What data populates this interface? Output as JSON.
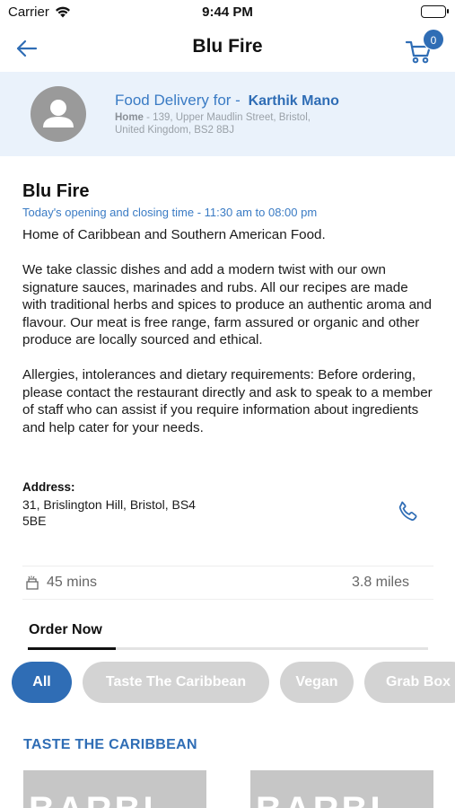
{
  "status_bar": {
    "carrier": "Carrier",
    "time": "9:44 PM"
  },
  "nav": {
    "title": "Blu Fire",
    "cart_count": "0"
  },
  "delivery": {
    "prefix": "Food Delivery for -",
    "customer_name": "Karthik Mano",
    "address_label": "Home",
    "address_text": " - 139, Upper Maudlin Street, Bristol, United Kingdom, BS2 8BJ"
  },
  "restaurant": {
    "name": "Blu Fire",
    "hours": "Today's opening and closing time - 11:30 am to 08:00 pm",
    "tagline": "Home of Caribbean and Southern American Food.",
    "description": "We take classic dishes and add a modern twist with our own signature sauces, marinades and rubs. All our recipes are made with traditional herbs and spices to produce an authentic aroma and flavour. Our meat is free range, farm assured or organic and other produce are locally sourced and ethical.",
    "allergy_note": "Allergies, intolerances and dietary requirements: Before ordering, please contact the restaurant directly and ask to speak to a member of staff who can assist if you require information about ingredients and help cater for your needs.",
    "address_label": "Address:",
    "address": "31, Brislington Hill, Bristol, BS4 5BE"
  },
  "stats": {
    "time": "45 mins",
    "distance": "3.8 miles"
  },
  "tabs": {
    "order_now": "Order Now"
  },
  "categories": [
    "All",
    "Taste The Caribbean",
    "Vegan",
    "Grab Box"
  ],
  "section": {
    "title": "TASTE THE CARIBBEAN"
  },
  "cards": [
    {
      "image_text": "BARBI"
    },
    {
      "image_text": "BARBI"
    }
  ],
  "colors": {
    "accent": "#2f6db5",
    "banner_bg": "#eaf2fb",
    "chip_inactive": "#d3d3d3"
  },
  "icons": {
    "back": "arrow-left-icon",
    "cart": "cart-icon",
    "phone": "phone-icon",
    "delivery_time": "delivery-box-icon",
    "avatar": "user-icon"
  }
}
